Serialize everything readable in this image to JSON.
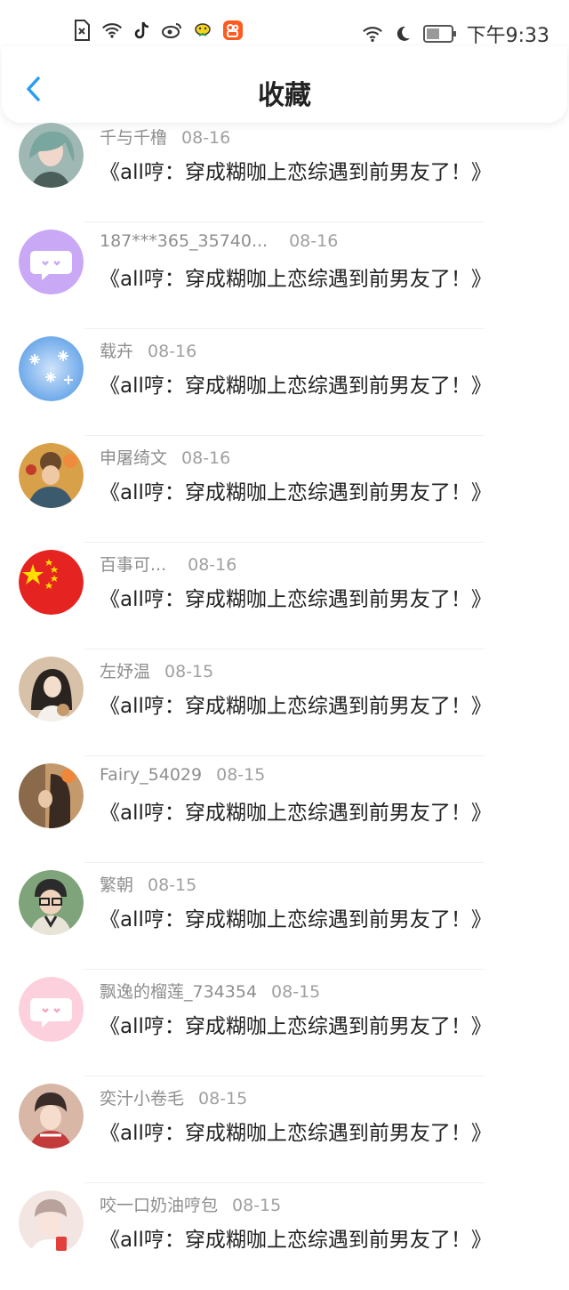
{
  "status_bar": {
    "time": "下午9:33",
    "left_icons": [
      "sim-missing-icon",
      "wifi-hotspot-icon",
      "tiktok-icon",
      "weibo-icon",
      "mascot-icon",
      "kuaishou-icon"
    ],
    "right_icons": [
      "wifi-icon",
      "moon-icon",
      "battery-icon"
    ]
  },
  "header": {
    "title": "收藏"
  },
  "items": [
    {
      "user": "千与千橹",
      "date": "08-16",
      "text": "《all哼：穿成糊咖上恋综遇到前男友了！》",
      "avatar_colors": [
        "#9fb8b3",
        "#4b5e5a"
      ]
    },
    {
      "user": "187***365_35740...",
      "date": "08-16",
      "text": "《all哼：穿成糊咖上恋综遇到前男友了！》",
      "avatar_colors": [
        "#c9a8f5",
        "#b892f0"
      ]
    },
    {
      "user": "载卉",
      "date": "08-16",
      "text": "《all哼：穿成糊咖上恋综遇到前男友了！》",
      "avatar_colors": [
        "#9ec9f3",
        "#5b9ee6"
      ]
    },
    {
      "user": "申屠绮文",
      "date": "08-16",
      "text": "《all哼：穿成糊咖上恋综遇到前男友了！》",
      "avatar_colors": [
        "#d9a04a",
        "#3b5a6d"
      ]
    },
    {
      "user": "百事可...",
      "date": "08-16",
      "text": "《all哼：穿成糊咖上恋综遇到前男友了！》",
      "avatar_colors": [
        "#e52421",
        "#e52421"
      ]
    },
    {
      "user": "左妤温",
      "date": "08-15",
      "text": "《all哼：穿成糊咖上恋综遇到前男友了！》",
      "avatar_colors": [
        "#d7c1a8",
        "#2a2421"
      ]
    },
    {
      "user": "Fairy_54029",
      "date": "08-15",
      "text": "《all哼：穿成糊咖上恋综遇到前男友了！》",
      "avatar_colors": [
        "#c49a6c",
        "#3a2b22"
      ]
    },
    {
      "user": "繁朝",
      "date": "08-15",
      "text": "《all哼：穿成糊咖上恋综遇到前男友了！》",
      "avatar_colors": [
        "#7fa37a",
        "#2b2b2b"
      ]
    },
    {
      "user": "飘逸的榴莲_734354",
      "date": "08-15",
      "text": "《all哼：穿成糊咖上恋综遇到前男友了！》",
      "avatar_colors": [
        "#fcd0dc",
        "#f8bccc"
      ]
    },
    {
      "user": "奕汁小卷毛",
      "date": "08-15",
      "text": "《all哼：穿成糊咖上恋综遇到前男友了！》",
      "avatar_colors": [
        "#d8b7a6",
        "#3a2c28"
      ]
    },
    {
      "user": "咬一口奶油哼包",
      "date": "08-15",
      "text": "《all哼：穿成糊咖上恋综遇到前男友了！》",
      "avatar_colors": [
        "#f3e6e2",
        "#c9a9a0"
      ]
    }
  ]
}
